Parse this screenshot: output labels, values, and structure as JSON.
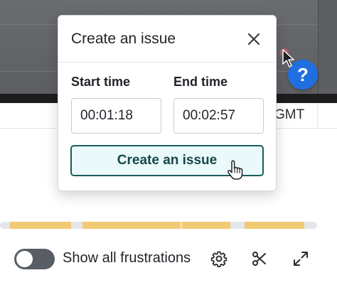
{
  "popover": {
    "title": "Create an issue",
    "close_icon": "close-icon",
    "start_label": "Start time",
    "end_label": "End time",
    "start_value": "00:01:18",
    "end_value": "00:02:57",
    "submit_label": "Create an issue"
  },
  "player": {
    "timezone_label": "GMT",
    "help_label": "?"
  },
  "timeline": {
    "segment_color": "#f2ca73",
    "track_color": "#e3e6ea"
  },
  "controls": {
    "toggle_label": "Show all frustrations",
    "toggle_on": false,
    "icons": [
      "gear-icon",
      "scissors-icon",
      "expand-icon"
    ]
  },
  "colors": {
    "accent": "#1d5c5e",
    "button_bg": "#eaf9fa",
    "help_blue": "#1f6fe0"
  }
}
